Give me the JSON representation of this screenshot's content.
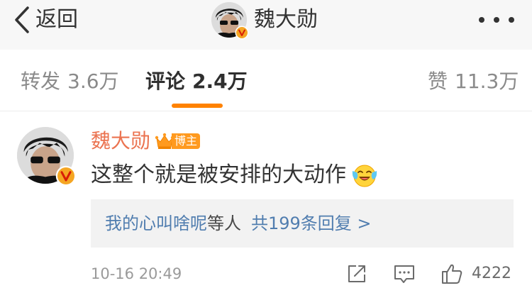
{
  "nav": {
    "back_label": "返回",
    "user_name": "魏大勋"
  },
  "tabs": {
    "repost": {
      "label": "转发",
      "count": "3.6万"
    },
    "comment": {
      "label": "评论",
      "count": "2.4万"
    },
    "like": {
      "label": "赞",
      "count": "11.3万"
    }
  },
  "comment": {
    "user_name": "魏大勋",
    "badge_label": "博主",
    "text": "这整个就是被安排的大动作",
    "emoji": "laughing-tears-emoji",
    "reply": {
      "users": "我的心叫啥呢",
      "etc": "等人",
      "total": "共199条回复 >"
    },
    "time": "10-16 20:49",
    "like_count": "4222"
  },
  "colors": {
    "accent": "#ff8200",
    "name": "#eb7350",
    "link": "#507daf",
    "nav_bg": "#f7f7f7",
    "verified": "#f5a623"
  }
}
